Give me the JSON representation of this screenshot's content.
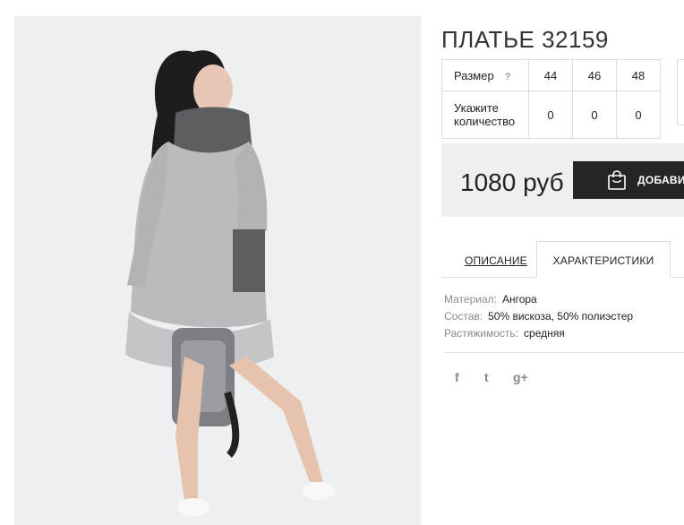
{
  "product": {
    "title": "ПЛАТЬЕ 32159",
    "image_alt": "photo-model-grey-dress"
  },
  "size_table": {
    "size_label": "Размер",
    "help_mark": "?",
    "sizes": [
      "44",
      "46",
      "48"
    ],
    "qty_label_line1": "Укажите",
    "qty_label_line2": "количество",
    "quantities": [
      "0",
      "0",
      "0"
    ]
  },
  "purchase": {
    "price": "1080 руб",
    "add_button_label": "ДОБАВИТЬ"
  },
  "tabs": {
    "description": "ОПИСАНИЕ",
    "characteristics": "ХАРАКТЕРИСТИКИ",
    "active": "characteristics"
  },
  "specs": [
    {
      "key": "Материал:",
      "value": "Ангора"
    },
    {
      "key": "Состав:",
      "value": "50% вискоза, 50% полиэстер"
    },
    {
      "key": "Растяжимость:",
      "value": "средняя"
    }
  ],
  "social": {
    "facebook": "f",
    "twitter": "t",
    "google": "g+"
  },
  "colors": {
    "button_bg": "#252525",
    "price_bg": "#efefef",
    "border": "#dcdcdc",
    "photo_bg": "#eeeff1"
  }
}
